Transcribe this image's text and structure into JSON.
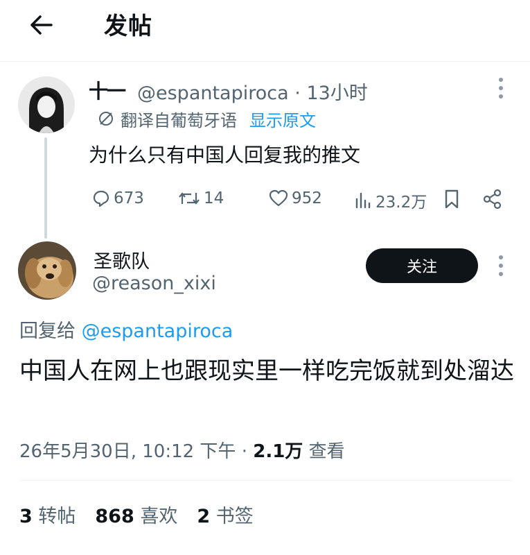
{
  "header": {
    "title": "发帖"
  },
  "original_tweet": {
    "display_name": "十一",
    "handle": "@espantapiroca",
    "separator": "·",
    "time": "13小时",
    "translation_note": "翻译自葡萄牙语",
    "show_original": "显示原文",
    "text": "为什么只有中国人回复我的推文",
    "replies": "673",
    "retweets": "14",
    "likes": "952",
    "views": "23.2万"
  },
  "reply_tweet": {
    "display_name": "圣歌队",
    "handle": "@reason_xixi",
    "follow_label": "关注",
    "replying_to_label": "回复给",
    "replying_to_handle": "@espantapiroca",
    "text": "中国人在网上也跟现实里一样吃完饭就到处溜达",
    "date": "26年5月30日, 10:12 下午",
    "separator": "·",
    "views_count": "2.1万",
    "views_label": "查看",
    "retweets_count": "3",
    "retweets_label": "转帖",
    "likes_count": "868",
    "likes_label": "喜欢",
    "bookmarks_count": "2",
    "bookmarks_label": "书签"
  },
  "icons": {
    "back": "arrow-left-icon",
    "more": "more-vertical-icon",
    "translate": "globe-slash-icon",
    "reply": "speech-bubble-icon",
    "retweet": "retweet-icon",
    "like": "heart-icon",
    "views": "bar-chart-icon",
    "bookmark": "bookmark-icon",
    "share": "share-icon"
  },
  "colors": {
    "accent": "#1d9bf0",
    "secondary_text": "#536471",
    "primary_text": "#0f1419",
    "follow_button": "#0f1419"
  }
}
